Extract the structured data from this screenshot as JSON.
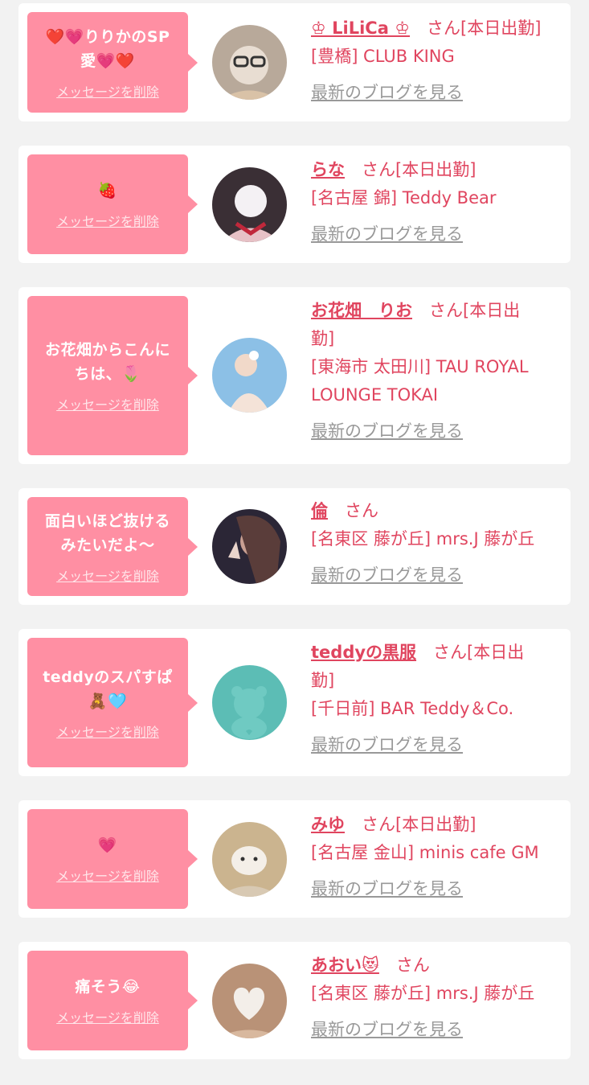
{
  "delete_label": "メッセージを削除",
  "san_label": "さん",
  "blog_label": "最新のブログを見る",
  "cards": [
    {
      "message": [
        "❤️💗りりかのSP",
        "愛💗❤️"
      ],
      "name": "♔ LiLiCa ♔",
      "status": "[本日出勤]",
      "shop": "[豊橋] CLUB KING",
      "avatar_colors": [
        "#b8a99a",
        "#e8ddd2"
      ]
    },
    {
      "message": [
        "🍓"
      ],
      "name": "らな",
      "status": "[本日出勤]",
      "shop": "[名古屋 錦] Teddy Bear",
      "avatar_colors": [
        "#3a2f35",
        "#e7c1c6"
      ]
    },
    {
      "message": [
        "お花畑からこんに",
        "ちは、🌷"
      ],
      "name": "お花畑　りお",
      "status": "[本日出",
      "status2": "勤]",
      "shop": "[東海市 太田川] TAU ROYAL",
      "shop2": "LOUNGE TOKAI",
      "avatar_colors": [
        "#8cc0e6",
        "#f1d9c9"
      ]
    },
    {
      "message": [
        "面白いほど抜ける",
        "みたいだよ〜"
      ],
      "name": "倫",
      "status": "",
      "shop": "[名東区 藤が丘] mrs.J 藤が丘",
      "avatar_colors": [
        "#2b2636",
        "#c9a093"
      ]
    },
    {
      "message": [
        "teddyのスパすぱ",
        "🧸🩵"
      ],
      "name": "teddyの黒服",
      "status": "[本日出",
      "status2": "勤]",
      "shop": "[千日前] BAR Teddy＆Co.",
      "avatar_colors": [
        "#5cbdb5",
        "#6fcac2"
      ]
    },
    {
      "message": [
        "💗"
      ],
      "name": "みゆ",
      "status": "[本日出勤]",
      "shop": "[名古屋 金山] minis cafe GM",
      "avatar_colors": [
        "#cbb48f",
        "#f4efe8"
      ]
    },
    {
      "message": [
        "痛そう😂"
      ],
      "name": "あおい😻",
      "status": "",
      "shop": "[名東区 藤が丘] mrs.J 藤が丘",
      "avatar_colors": [
        "#b99277",
        "#f3eee9"
      ]
    }
  ]
}
